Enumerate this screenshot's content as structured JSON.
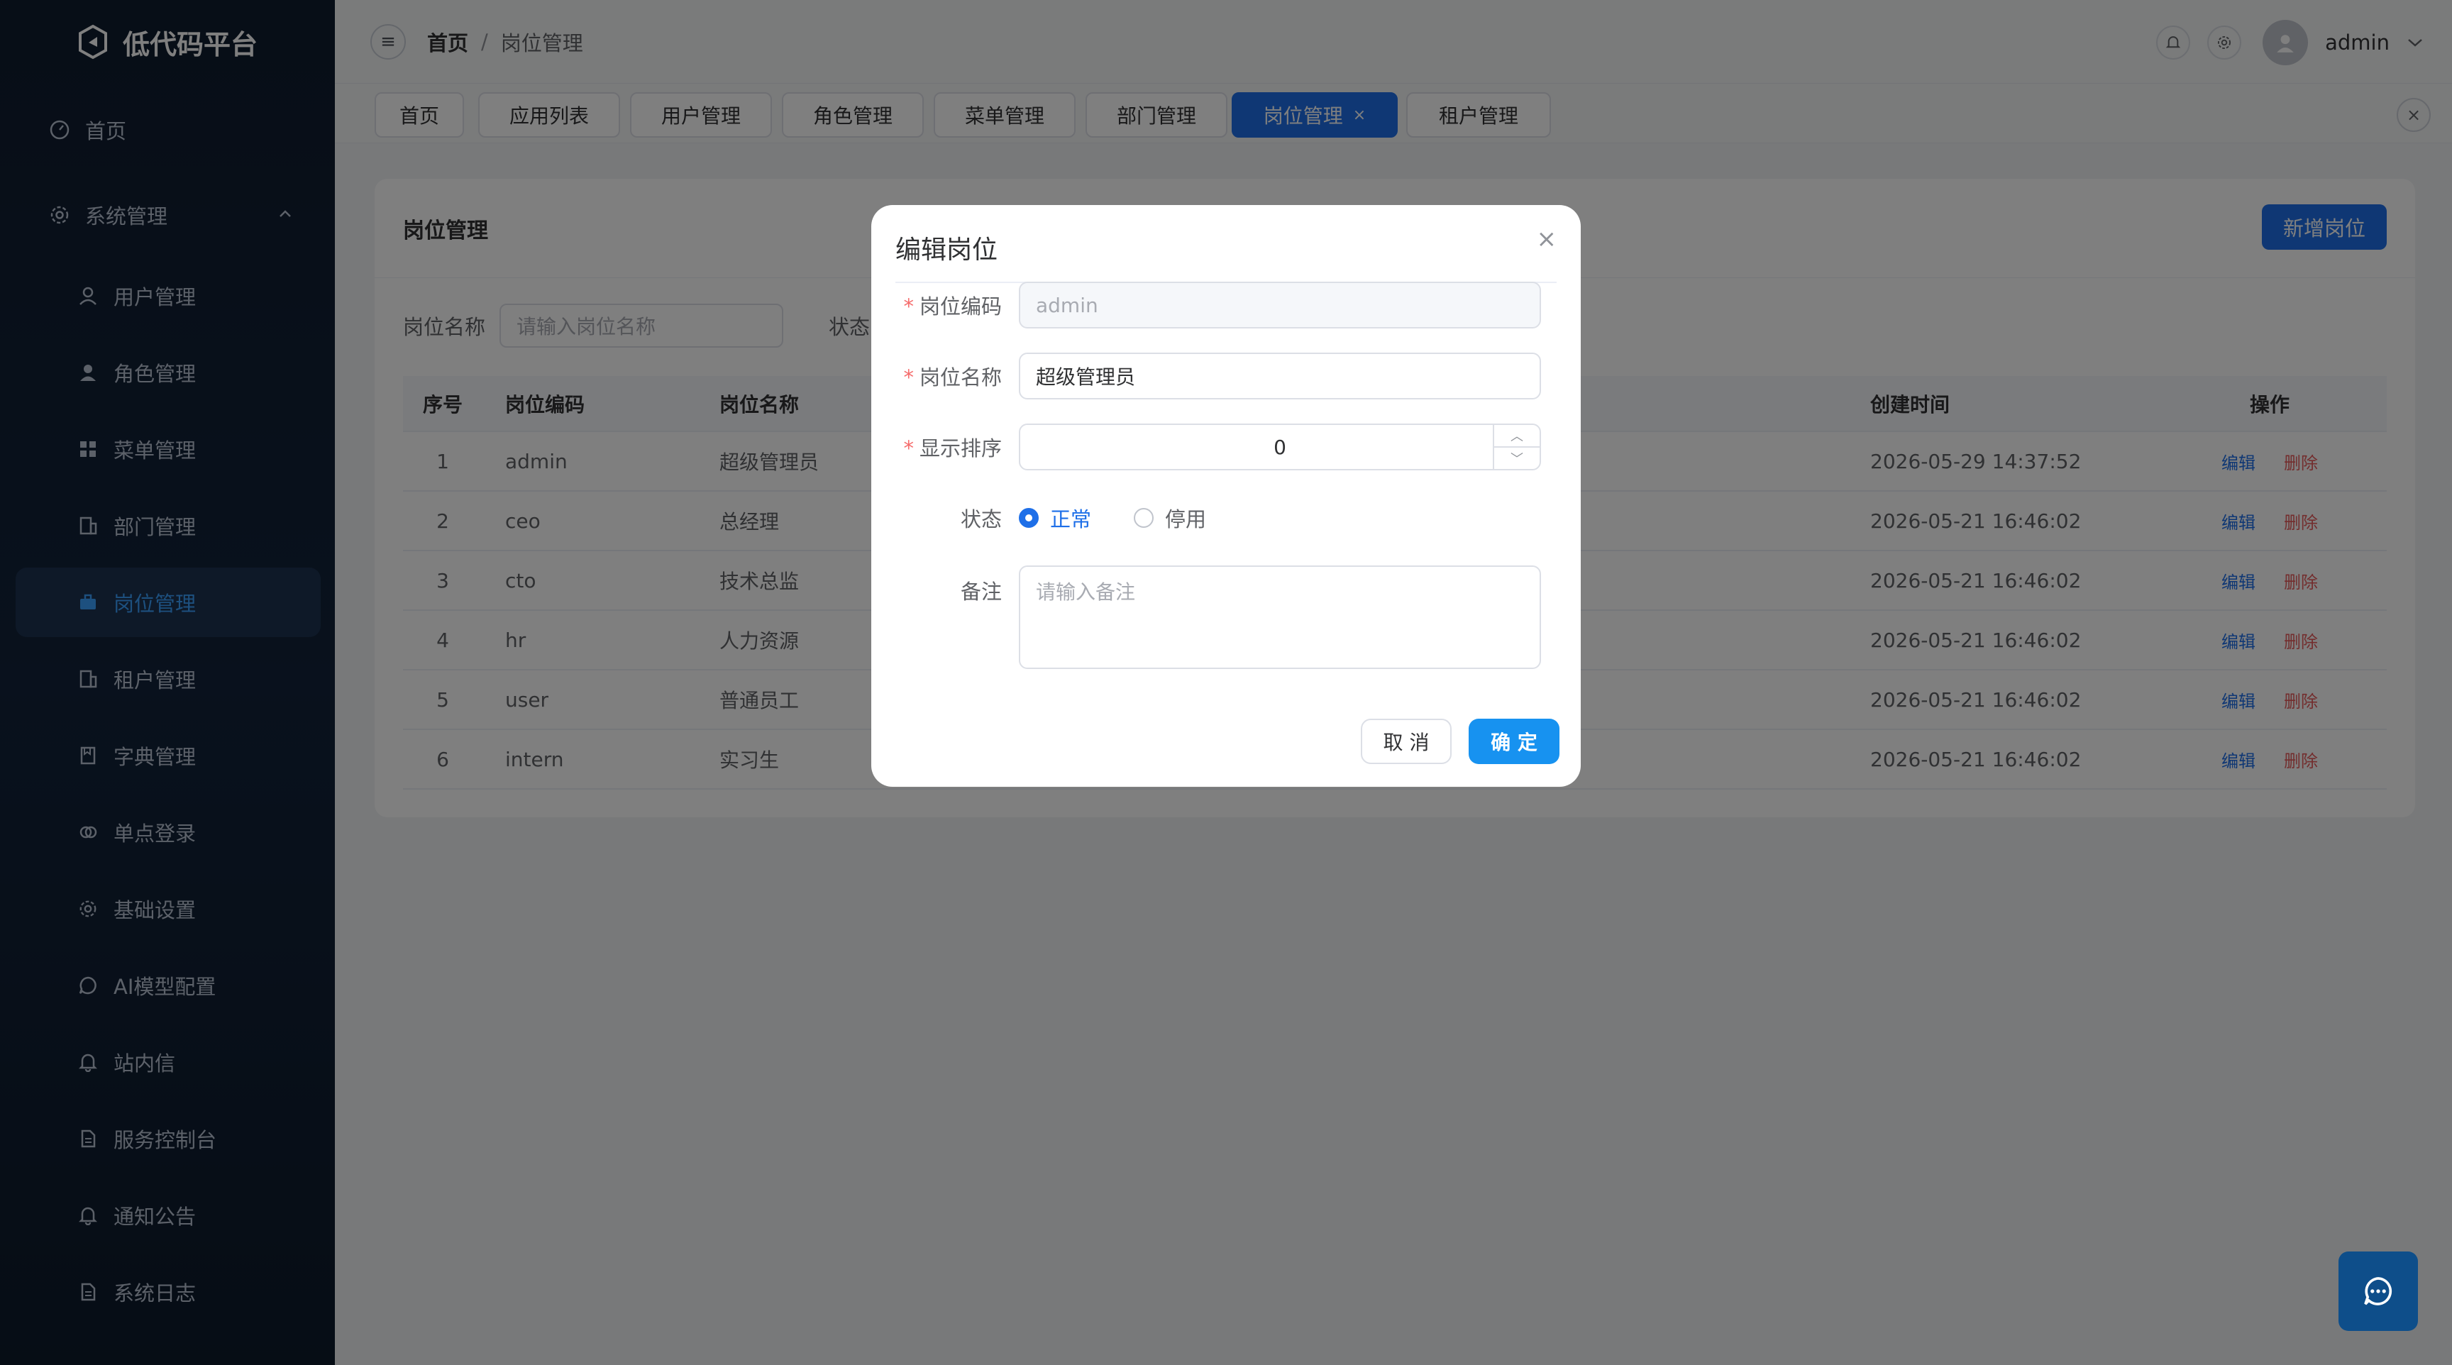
{
  "app": {
    "title": "低代码平台"
  },
  "sidebar": {
    "items": [
      {
        "label": "首页",
        "icon": "dashboard-icon"
      },
      {
        "label": "系统管理",
        "icon": "gear-icon"
      },
      {
        "label": "用户管理",
        "icon": "user-icon"
      },
      {
        "label": "角色管理",
        "icon": "user-filled-icon"
      },
      {
        "label": "菜单管理",
        "icon": "grid-icon"
      },
      {
        "label": "部门管理",
        "icon": "building-icon"
      },
      {
        "label": "岗位管理",
        "icon": "briefcase-icon",
        "active": true
      },
      {
        "label": "租户管理",
        "icon": "building-icon"
      },
      {
        "label": "字典管理",
        "icon": "book-icon"
      },
      {
        "label": "单点登录",
        "icon": "link-icon"
      },
      {
        "label": "基础设置",
        "icon": "gear-icon"
      },
      {
        "label": "AI模型配置",
        "icon": "chat-icon"
      },
      {
        "label": "站内信",
        "icon": "bell-icon"
      },
      {
        "label": "服务控制台",
        "icon": "document-icon"
      },
      {
        "label": "通知公告",
        "icon": "bell-icon"
      },
      {
        "label": "系统日志",
        "icon": "document-icon"
      }
    ]
  },
  "header": {
    "breadcrumb_home": "首页",
    "breadcrumb_sep": "/",
    "breadcrumb_current": "岗位管理",
    "username": "admin"
  },
  "tabs": [
    {
      "label": "首页"
    },
    {
      "label": "应用列表"
    },
    {
      "label": "用户管理"
    },
    {
      "label": "角色管理"
    },
    {
      "label": "菜单管理"
    },
    {
      "label": "部门管理"
    },
    {
      "label": "岗位管理",
      "active": true,
      "close": "×"
    },
    {
      "label": "租户管理"
    }
  ],
  "card": {
    "title": "岗位管理",
    "add_button": "新增岗位",
    "filter_label": "岗位名称",
    "filter_placeholder": "请输入岗位名称",
    "status_label": "状态"
  },
  "table": {
    "headers": {
      "idx": "序号",
      "code": "岗位编码",
      "name": "岗位名称",
      "created": "创建时间",
      "ops": "操作"
    },
    "edit_label": "编辑",
    "delete_label": "删除",
    "rows": [
      {
        "idx": "1",
        "code": "admin",
        "name": "超级管理员",
        "created": "2026-05-29 14:37:52"
      },
      {
        "idx": "2",
        "code": "ceo",
        "name": "总经理",
        "created": "2026-05-21 16:46:02"
      },
      {
        "idx": "3",
        "code": "cto",
        "name": "技术总监",
        "created": "2026-05-21 16:46:02"
      },
      {
        "idx": "4",
        "code": "hr",
        "name": "人力资源",
        "created": "2026-05-21 16:46:02"
      },
      {
        "idx": "5",
        "code": "user",
        "name": "普通员工",
        "created": "2026-05-21 16:46:02"
      },
      {
        "idx": "6",
        "code": "intern",
        "name": "实习生",
        "created": "2026-05-21 16:46:02"
      }
    ]
  },
  "dialog": {
    "title": "编辑岗位",
    "required_mark": "*",
    "code_label": "岗位编码",
    "code_value": "admin",
    "name_label": "岗位名称",
    "name_value": "超级管理员",
    "sort_label": "显示排序",
    "sort_value": "0",
    "status_label": "状态",
    "status_normal": "正常",
    "status_disabled": "停用",
    "remark_label": "备注",
    "remark_placeholder": "请输入备注",
    "cancel": "取 消",
    "confirm": "确 定"
  },
  "colors": {
    "primary": "#1e6fe8",
    "danger": "#e65a5a",
    "sidebar_bg": "#12233a"
  }
}
